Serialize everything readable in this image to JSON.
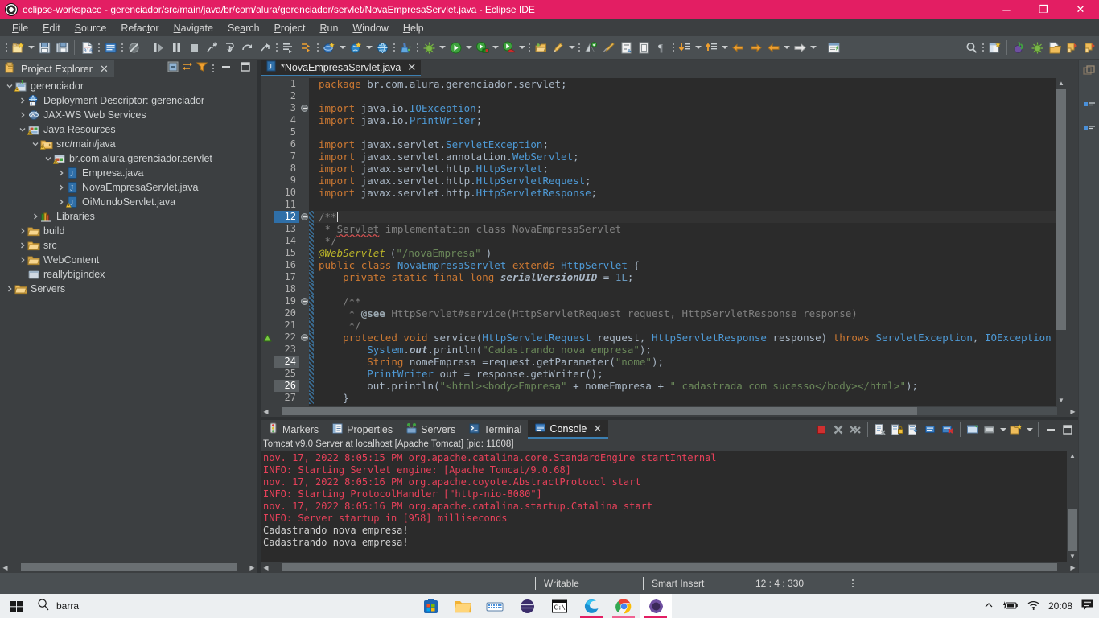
{
  "window": {
    "title": "eclipse-workspace - gerenciador/src/main/java/br/com/alura/gerenciador/servlet/NovaEmpresaServlet.java - Eclipse IDE",
    "app_icon": "eclipse-icon",
    "minimize_label": "─",
    "maximize_label": "❐",
    "close_label": "✕",
    "titlebar_color": "#e31e63"
  },
  "menubar": {
    "items": [
      {
        "label": "File",
        "mnemonic": "F"
      },
      {
        "label": "Edit",
        "mnemonic": "E"
      },
      {
        "label": "Source",
        "mnemonic": "S"
      },
      {
        "label": "Refactor",
        "mnemonic": "t"
      },
      {
        "label": "Navigate",
        "mnemonic": "N"
      },
      {
        "label": "Search",
        "mnemonic": "a"
      },
      {
        "label": "Project",
        "mnemonic": "P"
      },
      {
        "label": "Run",
        "mnemonic": "R"
      },
      {
        "label": "Window",
        "mnemonic": "W"
      },
      {
        "label": "Help",
        "mnemonic": "H"
      }
    ]
  },
  "project_explorer": {
    "tab_label": "Project Explorer",
    "tab_icon": "project-explorer-icon",
    "close_label": "✕",
    "toolbar": [
      {
        "name": "collapse-all-icon"
      },
      {
        "name": "link-with-editor-icon"
      },
      {
        "name": "view-menu-filter-icon"
      },
      {
        "name": "view-menu-icon"
      },
      {
        "name": "minimize-view-icon"
      },
      {
        "name": "maximize-view-icon"
      }
    ],
    "tree": [
      {
        "label": "gerenciador",
        "depth": 0,
        "twist": "down",
        "icon": "java-project-warning-icon"
      },
      {
        "label": "Deployment Descriptor: gerenciador",
        "depth": 1,
        "twist": "right",
        "icon": "deployment-descriptor-icon"
      },
      {
        "label": "JAX-WS Web Services",
        "depth": 1,
        "twist": "right",
        "icon": "jaxws-icon"
      },
      {
        "label": "Java Resources",
        "depth": 1,
        "twist": "down",
        "icon": "java-resources-warning-icon"
      },
      {
        "label": "src/main/java",
        "depth": 2,
        "twist": "down",
        "icon": "source-folder-warning-icon"
      },
      {
        "label": "br.com.alura.gerenciador.servlet",
        "depth": 3,
        "twist": "down",
        "icon": "package-warning-icon"
      },
      {
        "label": "Empresa.java",
        "depth": 4,
        "twist": "right",
        "icon": "java-file-icon"
      },
      {
        "label": "NovaEmpresaServlet.java",
        "depth": 4,
        "twist": "right",
        "icon": "java-file-icon"
      },
      {
        "label": "OiMundoServlet.java",
        "depth": 4,
        "twist": "right",
        "icon": "java-file-warning-icon"
      },
      {
        "label": "Libraries",
        "depth": 2,
        "twist": "right",
        "icon": "libraries-icon"
      },
      {
        "label": "build",
        "depth": 1,
        "twist": "right",
        "icon": "folder-icon"
      },
      {
        "label": "src",
        "depth": 1,
        "twist": "right",
        "icon": "folder-icon"
      },
      {
        "label": "WebContent",
        "depth": 1,
        "twist": "right",
        "icon": "folder-icon"
      },
      {
        "label": "reallybigindex",
        "depth": 1,
        "twist": "none",
        "icon": "file-icon"
      },
      {
        "label": "Servers",
        "depth": 0,
        "twist": "right",
        "icon": "folder-icon"
      }
    ]
  },
  "editor": {
    "tab_label": "*NovaEmpresaServlet.java",
    "tab_icon": "java-file-icon",
    "tab_close_label": "✕",
    "dirty": true,
    "lines": [
      {
        "n": 1,
        "fold": "",
        "annot": "",
        "cur": false,
        "mark": false
      },
      {
        "n": 2,
        "fold": "",
        "annot": "",
        "cur": false,
        "mark": false
      },
      {
        "n": 3,
        "fold": "collapse",
        "annot": "",
        "cur": false,
        "mark": false
      },
      {
        "n": 4,
        "fold": "",
        "annot": "",
        "cur": false,
        "mark": false
      },
      {
        "n": 5,
        "fold": "",
        "annot": "",
        "cur": false,
        "mark": false
      },
      {
        "n": 6,
        "fold": "",
        "annot": "",
        "cur": false,
        "mark": false
      },
      {
        "n": 7,
        "fold": "",
        "annot": "",
        "cur": false,
        "mark": false
      },
      {
        "n": 8,
        "fold": "",
        "annot": "",
        "cur": false,
        "mark": false
      },
      {
        "n": 9,
        "fold": "",
        "annot": "",
        "cur": false,
        "mark": false
      },
      {
        "n": 10,
        "fold": "",
        "annot": "",
        "cur": false,
        "mark": false
      },
      {
        "n": 11,
        "fold": "",
        "annot": "",
        "cur": false,
        "mark": false
      },
      {
        "n": 12,
        "fold": "collapse",
        "annot": "",
        "cur": true,
        "mark": false
      },
      {
        "n": 13,
        "fold": "",
        "annot": "",
        "cur": false,
        "mark": false
      },
      {
        "n": 14,
        "fold": "",
        "annot": "",
        "cur": false,
        "mark": false
      },
      {
        "n": 15,
        "fold": "",
        "annot": "",
        "cur": false,
        "mark": false
      },
      {
        "n": 16,
        "fold": "",
        "annot": "",
        "cur": false,
        "mark": false
      },
      {
        "n": 17,
        "fold": "",
        "annot": "",
        "cur": false,
        "mark": false
      },
      {
        "n": 18,
        "fold": "",
        "annot": "",
        "cur": false,
        "mark": false
      },
      {
        "n": 19,
        "fold": "collapse",
        "annot": "",
        "cur": false,
        "mark": false
      },
      {
        "n": 20,
        "fold": "",
        "annot": "",
        "cur": false,
        "mark": false
      },
      {
        "n": 21,
        "fold": "",
        "annot": "",
        "cur": false,
        "mark": false
      },
      {
        "n": 22,
        "fold": "collapse",
        "annot": "warning",
        "cur": false,
        "mark": false
      },
      {
        "n": 23,
        "fold": "",
        "annot": "",
        "cur": false,
        "mark": false
      },
      {
        "n": 24,
        "fold": "",
        "annot": "",
        "cur": false,
        "mark": true
      },
      {
        "n": 25,
        "fold": "",
        "annot": "",
        "cur": false,
        "mark": false
      },
      {
        "n": 26,
        "fold": "",
        "annot": "",
        "cur": false,
        "mark": true
      },
      {
        "n": 27,
        "fold": "",
        "annot": "",
        "cur": false,
        "mark": false
      }
    ],
    "code_text": [
      "package br.com.alura.gerenciador.servlet;",
      "",
      "import java.io.IOException;",
      "import java.io.PrintWriter;",
      "",
      "import javax.servlet.ServletException;",
      "import javax.servlet.annotation.WebServlet;",
      "import javax.servlet.http.HttpServlet;",
      "import javax.servlet.http.HttpServletRequest;",
      "import javax.servlet.http.HttpServletResponse;",
      "",
      "/**",
      " * Servlet implementation class NovaEmpresaServlet",
      " */",
      "@WebServlet(\"/novaEmpresa\")",
      "public class NovaEmpresaServlet extends HttpServlet {",
      "    private static final long serialVersionUID = 1L;",
      "",
      "    /**",
      "     * @see HttpServlet#service(HttpServletRequest request, HttpServletResponse response)",
      "     */",
      "    protected void service(HttpServletRequest request, HttpServletResponse response) throws ServletException, IOException {",
      "        System.out.println(\"Cadastrando nova empresa\");",
      "        String nomeEmpresa =request.getParameter(\"nome\");",
      "        PrintWriter out = response.getWriter();",
      "        out.println(\"<html><body>Empresa\" + nomeEmpresa + \" cadastrada com sucesso</body></html>\");",
      "    }"
    ]
  },
  "console": {
    "tabs": [
      {
        "label": "Markers",
        "icon": "markers-icon",
        "active": false
      },
      {
        "label": "Properties",
        "icon": "properties-icon",
        "active": false
      },
      {
        "label": "Servers",
        "icon": "servers-icon",
        "active": false
      },
      {
        "label": "Terminal",
        "icon": "terminal-icon",
        "active": false
      },
      {
        "label": "Console",
        "icon": "console-icon",
        "active": true
      }
    ],
    "close_label": "✕",
    "toolbar": [
      {
        "name": "terminate-icon"
      },
      {
        "name": "remove-launch-icon"
      },
      {
        "name": "remove-all-terminated-icon"
      },
      {
        "name": "clear-console-icon"
      },
      {
        "name": "scroll-lock-icon"
      },
      {
        "name": "word-wrap-icon"
      },
      {
        "name": "show-console-on-output-icon"
      },
      {
        "name": "show-console-on-error-icon"
      },
      {
        "name": "pin-console-icon"
      },
      {
        "name": "display-selected-console-icon"
      },
      {
        "name": "open-console-icon"
      },
      {
        "name": "minimize-view-icon"
      },
      {
        "name": "maximize-view-icon"
      }
    ],
    "title": "Tomcat v9.0 Server at localhost [Apache Tomcat]  [pid: 11608]",
    "output": [
      {
        "text": "nov. 17, 2022 8:05:15 PM org.apache.catalina.core.StandardEngine startInternal",
        "kind": "err"
      },
      {
        "text": "INFO: Starting Servlet engine: [Apache Tomcat/9.0.68]",
        "kind": "err"
      },
      {
        "text": "nov. 17, 2022 8:05:16 PM org.apache.coyote.AbstractProtocol start",
        "kind": "err"
      },
      {
        "text": "INFO: Starting ProtocolHandler [\"http-nio-8080\"]",
        "kind": "err"
      },
      {
        "text": "nov. 17, 2022 8:05:16 PM org.apache.catalina.startup.Catalina start",
        "kind": "err"
      },
      {
        "text": "INFO: Server startup in [958] milliseconds",
        "kind": "err"
      },
      {
        "text": "Cadastrando nova empresa!",
        "kind": "out"
      },
      {
        "text": "Cadastrando nova empresa!",
        "kind": "out"
      }
    ]
  },
  "statusbar": {
    "writable": "Writable",
    "insert_mode": "Smart Insert",
    "position": "12 : 4 : 330"
  },
  "taskbar": {
    "start_icon": "windows-start-icon",
    "search_icon": "search-icon",
    "search_text": "barra",
    "apps": [
      {
        "name": "microsoft-store-icon",
        "accent": "#1e66b3",
        "pinned": false
      },
      {
        "name": "file-explorer-icon",
        "accent": "#f2b233",
        "pinned": false
      },
      {
        "name": "keyboard-icon",
        "accent": "#4a90d9",
        "pinned": false
      },
      {
        "name": "tomcat-icon",
        "accent": "#3b2d6b",
        "pinned": false
      },
      {
        "name": "command-prompt-icon",
        "accent": "#111111",
        "pinned": false
      },
      {
        "name": "microsoft-edge-icon",
        "accent": "#0f7ec8",
        "pinned": true
      },
      {
        "name": "google-chrome-icon",
        "accent": "#dd4b39",
        "pinned": true
      },
      {
        "name": "eclipse-ide-icon",
        "accent": "#6e4fa0",
        "pinned": true
      }
    ],
    "tray": {
      "chevron": "show-hidden-icons",
      "battery": "battery-charging-icon",
      "wifi": "wifi-icon",
      "clock": "20:08",
      "notifications": "notifications-icon"
    }
  }
}
